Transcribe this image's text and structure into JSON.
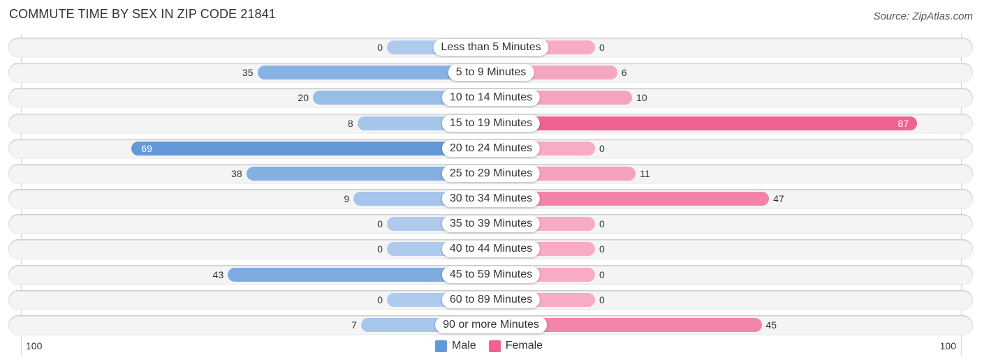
{
  "header": {
    "title": "COMMUTE TIME BY SEX IN ZIP CODE 21841",
    "source": "Source: ZipAtlas.com"
  },
  "axis": {
    "left_label": "100",
    "right_label": "100"
  },
  "legend": [
    {
      "label": "Male",
      "color": "#6399d8"
    },
    {
      "label": "Female",
      "color": "#f06292"
    }
  ],
  "colors": {
    "male_strong": "#6399d8",
    "male_light": "#aecbee",
    "female_strong": "#f06292",
    "female_light": "#f7abc4"
  },
  "chart_data": {
    "type": "bar",
    "orientation": "horizontal-diverging",
    "title": "COMMUTE TIME BY SEX IN ZIP CODE 21841",
    "xlabel": "",
    "ylabel": "",
    "xlim": [
      0,
      100
    ],
    "x_tick_labels": [
      "100",
      "100"
    ],
    "grid": false,
    "legend_position": "bottom-center",
    "categories": [
      "Less than 5 Minutes",
      "5 to 9 Minutes",
      "10 to 14 Minutes",
      "15 to 19 Minutes",
      "20 to 24 Minutes",
      "25 to 29 Minutes",
      "30 to 34 Minutes",
      "35 to 39 Minutes",
      "40 to 44 Minutes",
      "45 to 59 Minutes",
      "60 to 89 Minutes",
      "90 or more Minutes"
    ],
    "series": [
      {
        "name": "Male",
        "side": "left",
        "values": [
          0,
          35,
          20,
          8,
          69,
          38,
          9,
          0,
          0,
          43,
          0,
          7
        ]
      },
      {
        "name": "Female",
        "side": "right",
        "values": [
          0,
          6,
          10,
          87,
          0,
          11,
          47,
          0,
          0,
          0,
          0,
          45
        ]
      }
    ]
  }
}
